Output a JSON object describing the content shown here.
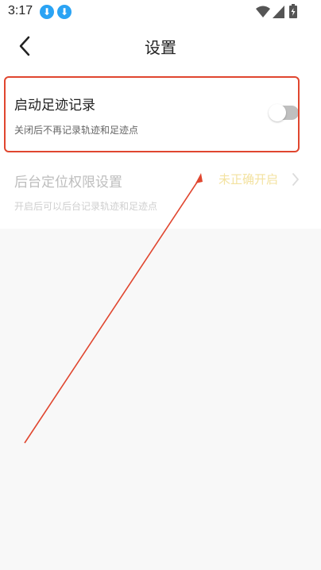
{
  "status_bar": {
    "time": "3:17",
    "icons": [
      "download-icon",
      "download-icon",
      "wifi-icon",
      "signal-icon",
      "battery-icon"
    ]
  },
  "nav": {
    "title": "设置",
    "back_icon": "chevron-left-icon"
  },
  "settings": {
    "footprint": {
      "title": "启动足迹记录",
      "description": "关闭后不再记录轨迹和足迹点",
      "toggle_on": false
    },
    "background_location": {
      "title": "后台定位权限设置",
      "description": "开启后可以后台记录轨迹和足迹点",
      "status": "未正确开启",
      "chevron_icon": "chevron-right-icon"
    }
  },
  "colors": {
    "highlight": "#e0462f",
    "status_accent": "#f3e2a0",
    "download_badge": "#2aa3f4"
  }
}
